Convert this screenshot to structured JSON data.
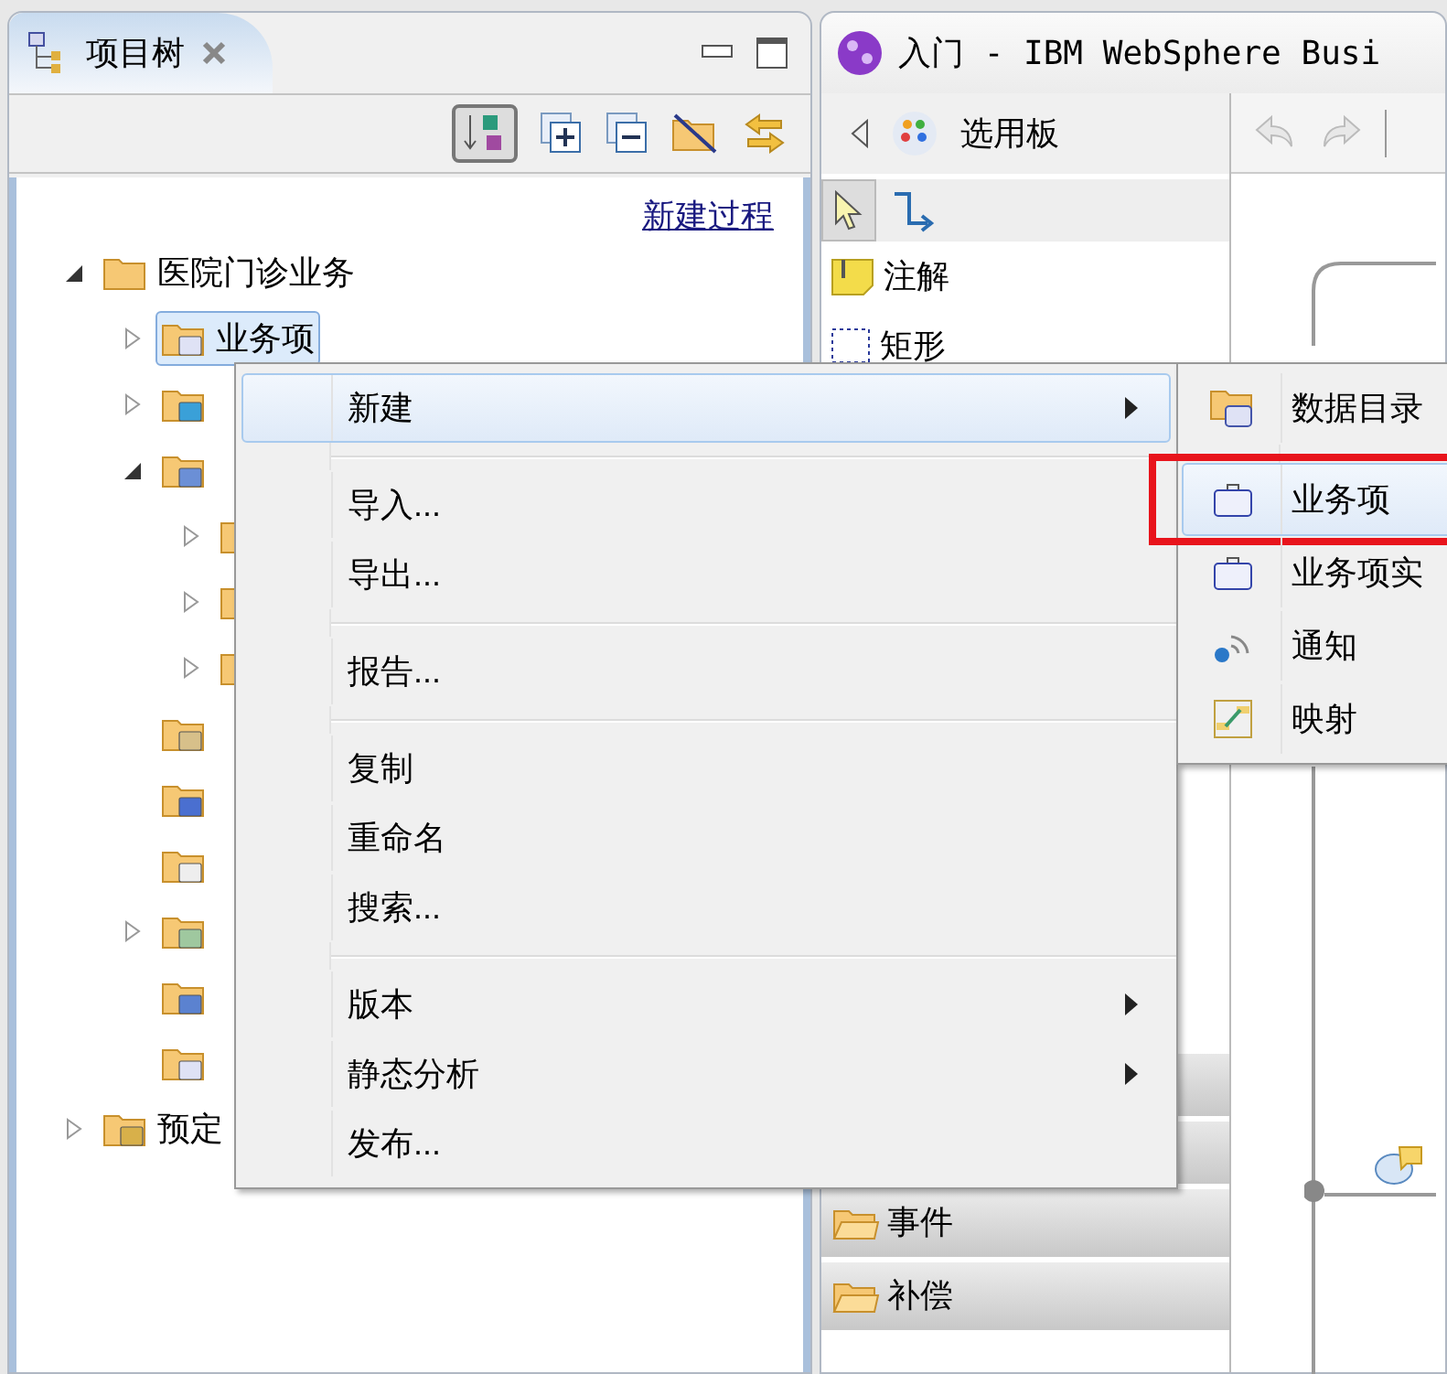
{
  "project_tree": {
    "title": "项目树",
    "new_process_link": "新建过程",
    "items": [
      {
        "label": "医院门诊业务",
        "expanded": true,
        "children": [
          {
            "label": "业务项",
            "expanded": false,
            "selected": true
          },
          {
            "expanded": false,
            "selected": false
          },
          {
            "expanded": true,
            "selected": false,
            "children": [
              {
                "expanded": false,
                "selected": false
              },
              {
                "expanded": false,
                "selected": false
              },
              {
                "expanded": false,
                "selected": false
              }
            ]
          },
          {
            "selected": false
          },
          {
            "selected": false
          },
          {
            "selected": false
          },
          {
            "expanded": false,
            "selected": false
          },
          {
            "selected": false
          },
          {
            "selected": false
          }
        ]
      },
      {
        "label": "预定",
        "expanded": false,
        "selected": false
      }
    ]
  },
  "editor": {
    "tab_title": "入门 - IBM WebSphere Busi",
    "palette": {
      "title": "选用板",
      "tools": [
        {
          "label": "注解"
        },
        {
          "label": "矩形"
        }
      ],
      "drawers": [
        {
          "label": "事件"
        },
        {
          "label": "补偿"
        }
      ]
    }
  },
  "context_menu": {
    "items": [
      {
        "kind": "item",
        "label": "新建",
        "submenu": true,
        "selected": true
      },
      {
        "kind": "separator"
      },
      {
        "kind": "item",
        "label": "导入...",
        "submenu": false,
        "selected": false
      },
      {
        "kind": "item",
        "label": "导出...",
        "submenu": false,
        "selected": false
      },
      {
        "kind": "separator"
      },
      {
        "kind": "item",
        "label": "报告...",
        "submenu": false,
        "selected": false
      },
      {
        "kind": "separator"
      },
      {
        "kind": "item",
        "label": "复制",
        "submenu": false,
        "selected": false
      },
      {
        "kind": "item",
        "label": "重命名",
        "submenu": false,
        "selected": false
      },
      {
        "kind": "item",
        "label": "搜索...",
        "submenu": false,
        "selected": false
      },
      {
        "kind": "separator"
      },
      {
        "kind": "item",
        "label": "版本",
        "submenu": true,
        "selected": false
      },
      {
        "kind": "item",
        "label": "静态分析",
        "submenu": true,
        "selected": false
      },
      {
        "kind": "item",
        "label": "发布...",
        "submenu": false,
        "selected": false
      }
    ]
  },
  "submenu": {
    "items": [
      {
        "kind": "item",
        "label": "数据目录",
        "selected": false,
        "marked": false
      },
      {
        "kind": "separator"
      },
      {
        "kind": "item",
        "label": "业务项",
        "selected": true,
        "marked": true
      },
      {
        "kind": "item",
        "label": "业务项实",
        "selected": false,
        "marked": false
      },
      {
        "kind": "item",
        "label": "通知",
        "selected": false,
        "marked": false
      },
      {
        "kind": "item",
        "label": "映射",
        "selected": false,
        "marked": false
      }
    ]
  }
}
